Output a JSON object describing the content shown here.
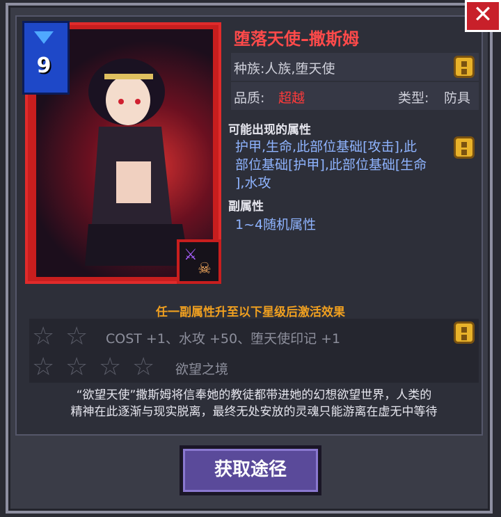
{
  "card": {
    "cost": "9"
  },
  "item": {
    "name": "堕落天使–撒斯姆",
    "race": "种族:人族,堕天使",
    "quality_label": "品质:",
    "quality_value": "超越",
    "type_label": "类型:",
    "type_value": "防具"
  },
  "attributes": {
    "possible_label": "可能出现的属性",
    "possible_line1": "护甲,生命,此部位基础[攻击],此",
    "possible_line2": "部位基础[护甲],此部位基础[生命",
    "possible_line3": "],水攻",
    "sub_label": "副属性",
    "sub_value": "1~4随机属性"
  },
  "activation": {
    "header": "任一副属性升至以下星级后激活效果",
    "tier1_text": "COST +1、水攻 +50、堕天使印记 +1",
    "tier2_text": "欲望之境"
  },
  "description": {
    "line1": "“欲望天使”撒斯姆将信奉她的教徒都带进她的幻想欲望世界，人类的",
    "line2": "精神在此逐渐与现实脱离，最终无处安放的灵魂只能游离在虚无中等待"
  },
  "buttons": {
    "obtain": "获取途径",
    "close": "✕"
  },
  "colors": {
    "quality": "#ff3a3a",
    "title": "#ff4a4a",
    "accent": "#f0a020",
    "attr": "#8fb4ff"
  }
}
